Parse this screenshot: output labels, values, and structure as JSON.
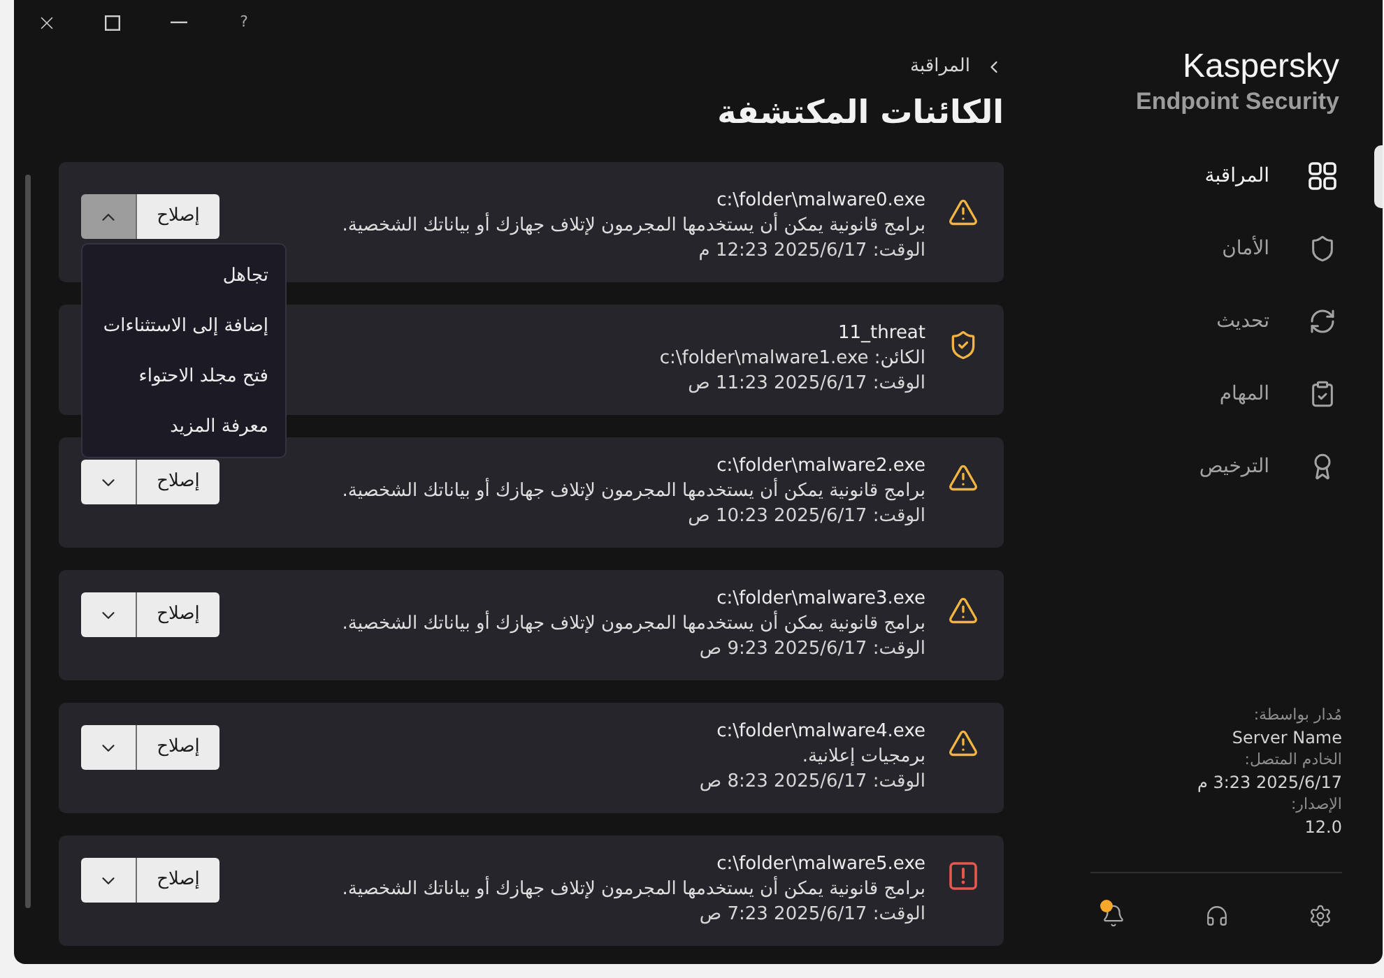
{
  "window": {
    "controls": [
      {
        "kind": "close"
      },
      {
        "kind": "maximize"
      },
      {
        "kind": "minimize"
      },
      {
        "kind": "help",
        "label": "?"
      }
    ]
  },
  "sidebar": {
    "brand": {
      "name": "Kaspersky",
      "product": "Endpoint Security"
    },
    "nav": [
      {
        "label": "المراقبة",
        "selected": true
      },
      {
        "label": "الأمان",
        "selected": false
      },
      {
        "label": "تحديث",
        "selected": false
      },
      {
        "label": "المهام",
        "selected": false
      },
      {
        "label": "الترخيص",
        "selected": false
      }
    ],
    "info": [
      {
        "label": "مُدار بواسطة:",
        "value": "Server Name"
      },
      {
        "label": "الخادم المتصل:",
        "value": "2025/6/17 3:23 م"
      },
      {
        "label": "الإصدار:",
        "value": "12.0"
      }
    ],
    "footer": [
      {
        "kind": "settings"
      },
      {
        "kind": "support"
      },
      {
        "kind": "notifications",
        "badge": true
      }
    ]
  },
  "breadcrumb": {
    "label": "المراقبة"
  },
  "page_title": "الكائنات المكتشفة",
  "detections": [
    {
      "kind": "warning",
      "title": "c:\\folder\\malware0.exe",
      "detail": "برامج قانونية يمكن أن يستخدمها المجرمون لإتلاف جهازك أو بياناتك الشخصية.",
      "time": "الوقت: 2025/6/17 12:23 م",
      "fix": {
        "label": "إصلاح",
        "expanded": true,
        "menu": [
          "تجاهل",
          "إضافة إلى الاستثناءات",
          "فتح مجلد الاحتواء",
          "معرفة المزيد"
        ]
      }
    },
    {
      "kind": "threat",
      "title": "11_threat",
      "detail": "الكائن: c:\\folder\\malware1.exe",
      "time": "الوقت: 2025/6/17 11:23 ص"
    },
    {
      "kind": "warning",
      "title": "c:\\folder\\malware2.exe",
      "detail": "برامج قانونية يمكن أن يستخدمها المجرمون لإتلاف جهازك أو بياناتك الشخصية.",
      "time": "الوقت: 2025/6/17 10:23 ص",
      "fix": {
        "label": "إصلاح",
        "expanded": false
      }
    },
    {
      "kind": "warning",
      "title": "c:\\folder\\malware3.exe",
      "detail": "برامج قانونية يمكن أن يستخدمها المجرمون لإتلاف جهازك أو بياناتك الشخصية.",
      "time": "الوقت: 2025/6/17 9:23 ص",
      "fix": {
        "label": "إصلاح",
        "expanded": false
      }
    },
    {
      "kind": "warning",
      "title": "c:\\folder\\malware4.exe",
      "detail": "برمجيات إعلانية.",
      "time": "الوقت: 2025/6/17 8:23 ص",
      "fix": {
        "label": "إصلاح",
        "expanded": false
      }
    },
    {
      "kind": "critical",
      "title": "c:\\folder\\malware5.exe",
      "detail": "برامج قانونية يمكن أن يستخدمها المجرمون لإتلاف جهازك أو بياناتك الشخصية.",
      "time": "الوقت: 2025/6/17 7:23 ص",
      "fix": {
        "label": "إصلاح",
        "expanded": false
      }
    }
  ]
}
